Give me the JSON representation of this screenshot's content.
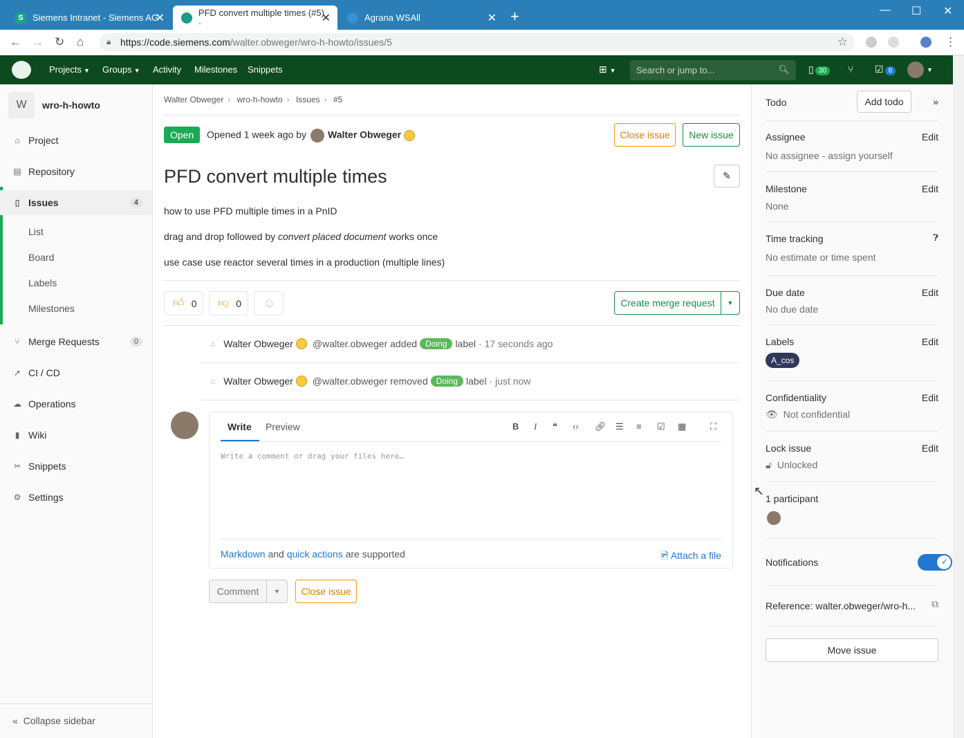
{
  "browser": {
    "tabs": [
      {
        "label": "Siemens Intranet - Siemens AG",
        "icon": "S"
      },
      {
        "label": "PFD convert multiple times (#5) ·",
        "icon": ""
      },
      {
        "label": "Agrana WSAll",
        "icon": ""
      }
    ],
    "url_host": "https://code.siemens.com",
    "url_path": "/walter.obweger/wro-h-howto/issues/5"
  },
  "header": {
    "nav": [
      "Projects",
      "Groups",
      "Activity",
      "Milestones",
      "Snippets"
    ],
    "search_placeholder": "Search or jump to...",
    "issues_count": "30",
    "todos_count": "8"
  },
  "sidebar": {
    "avatar_letter": "W",
    "project_name": "wro-h-howto",
    "items": [
      {
        "label": "Project",
        "icon": "home-icon"
      },
      {
        "label": "Repository",
        "icon": "book-icon"
      },
      {
        "label": "Issues",
        "count": "4",
        "icon": "issues-icon"
      },
      {
        "label": "Merge Requests",
        "count": "0",
        "icon": "merge-request-icon"
      },
      {
        "label": "CI / CD",
        "icon": "rocket-icon"
      },
      {
        "label": "Operations",
        "icon": "cloud-gear-icon"
      },
      {
        "label": "Wiki",
        "icon": "book-icon"
      },
      {
        "label": "Snippets",
        "icon": "scissors-icon"
      },
      {
        "label": "Settings",
        "icon": "gear-icon"
      }
    ],
    "subitems": [
      "List",
      "Board",
      "Labels",
      "Milestones"
    ],
    "collapse": "Collapse sidebar"
  },
  "issue": {
    "breadcrumbs": [
      "Walter Obweger",
      "wro-h-howto",
      "Issues",
      "#5"
    ],
    "status": "Open",
    "opened_text": "Opened 1 week ago by",
    "author": "Walter Obweger",
    "close_label": "Close issue",
    "new_label": "New issue",
    "title": "PFD convert multiple times",
    "desc1": "how to use PFD multiple times in a PnID",
    "desc2_pre": "drag and drop followed by ",
    "desc2_em": "convert placed document",
    "desc2_post": " works once",
    "desc3": "use case use reactor several times in a production (multiple lines)",
    "thumbs_up": "0",
    "thumbs_down": "0",
    "create_mr": "Create merge request"
  },
  "notes": [
    {
      "name": "Walter Obweger",
      "handle": "@walter.obweger added",
      "label": "Doing",
      "suffix": "label",
      "time": "· 17 seconds ago"
    },
    {
      "name": "Walter Obweger",
      "handle": "@walter.obweger removed",
      "label": "Doing",
      "suffix": "label",
      "time": "· just now"
    }
  ],
  "editor": {
    "write": "Write",
    "preview": "Preview",
    "placeholder": "Write a comment or drag your files here…",
    "markdown": "Markdown",
    "and": "and",
    "quick_actions": "quick actions",
    "supported": "are supported",
    "attach": "Attach a file",
    "comment": "Comment",
    "close": "Close issue"
  },
  "right": {
    "todo": "Todo",
    "add_todo": "Add todo",
    "edit": "Edit",
    "assignee_title": "Assignee",
    "assignee_val": "No assignee - assign yourself",
    "milestone_title": "Milestone",
    "milestone_val": "None",
    "time_title": "Time tracking",
    "time_val": "No estimate or time spent",
    "due_title": "Due date",
    "due_val": "No due date",
    "labels_title": "Labels",
    "label_pill": "A_cos",
    "conf_title": "Confidentiality",
    "conf_val": "Not confidential",
    "lock_title": "Lock issue",
    "lock_val": "Unlocked",
    "participants": "1 participant",
    "notifications": "Notifications",
    "reference": "Reference: walter.obweger/wro-h...",
    "move": "Move issue"
  }
}
